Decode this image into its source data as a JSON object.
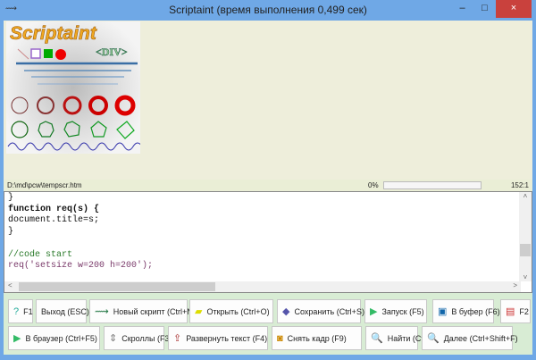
{
  "window": {
    "title": "Scriptaint (время выполнения 0,499 сек)",
    "minimize": "–",
    "maximize": "□",
    "close": "×"
  },
  "logo": {
    "text": "Scriptaint",
    "sub": "<DIV>"
  },
  "status": {
    "path": "D:\\md\\pcw\\tempscr.htm",
    "progress_label": "0%",
    "progress": 0,
    "position": "152:1"
  },
  "editor": {
    "lines": [
      "}",
      "",
      "function req(s) {",
      "document.title=s;",
      "}",
      "",
      "//code start",
      "req('setsize w=200 h=200');"
    ]
  },
  "toolbar": {
    "row1": [
      {
        "icon": "help-icon",
        "glyph": "?",
        "label": "F1"
      },
      {
        "icon": "",
        "glyph": "",
        "label": "Выход (ESC)"
      },
      {
        "icon": "new-script-icon",
        "glyph": "⟿",
        "label": "Новый скрипт (Ctrl+N)"
      },
      {
        "icon": "folder-icon",
        "glyph": "▰",
        "label": "Открыть (Ctrl+O)"
      },
      {
        "icon": "save-icon",
        "glyph": "◆",
        "label": "Сохранить (Ctrl+S)"
      },
      {
        "icon": "play-icon",
        "glyph": "▶",
        "label": "Запуск (F5)"
      },
      {
        "icon": "clipboard-icon",
        "glyph": "▣",
        "label": "В буфер (F6)"
      },
      {
        "icon": "window-icon",
        "glyph": "▤",
        "label": "F2"
      }
    ],
    "row2": [
      {
        "icon": "play-icon",
        "glyph": "▶",
        "label": "В браузер (Ctrl+F5)"
      },
      {
        "icon": "scroll-icon",
        "glyph": "⇕",
        "label": "Скроллы (F3)"
      },
      {
        "icon": "expand-icon",
        "glyph": "⇪",
        "label": "Развернуть текст (F4)"
      },
      {
        "icon": "camera-icon",
        "glyph": "◙",
        "label": "Снять кадр (F9)"
      },
      {
        "icon": "search-icon",
        "glyph": "🔍",
        "label": "Найти (Ctrl+F)"
      },
      {
        "icon": "search-next-icon",
        "glyph": "🔍",
        "label": "Далее (Ctrl+Shift+F)"
      }
    ]
  }
}
